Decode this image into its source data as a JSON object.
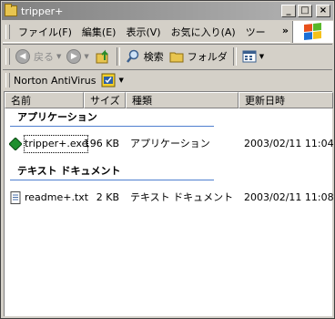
{
  "window": {
    "title": "tripper+",
    "buttons": {
      "minimize": "_",
      "maximize": "□",
      "close": "×"
    }
  },
  "menubar": {
    "items": [
      "ファイル(F)",
      "編集(E)",
      "表示(V)",
      "お気に入り(A)",
      "ツー"
    ],
    "more": "»"
  },
  "toolbar": {
    "back_label": "戻る",
    "search_label": "検索",
    "folders_label": "フォルダ"
  },
  "norton": {
    "label": "Norton AntiVirus"
  },
  "list": {
    "columns": [
      "名前",
      "サイズ",
      "種類",
      "更新日時"
    ],
    "groups": [
      {
        "title": "アプリケーション",
        "files": [
          {
            "name": "tripper+.exe",
            "size": "196 KB",
            "type": "アプリケーション",
            "modified": "2003/02/11 11:04",
            "icon": "exe-icon"
          }
        ]
      },
      {
        "title": "テキスト ドキュメント",
        "files": [
          {
            "name": "readme+.txt",
            "size": "2 KB",
            "type": "テキスト ドキュメント",
            "modified": "2003/02/11 11:08",
            "icon": "text-document-icon"
          }
        ]
      }
    ]
  },
  "colors": {
    "title_gradient_start": "#808080",
    "group_line": "#4f7fcf",
    "chrome": "#d4d0c8"
  }
}
